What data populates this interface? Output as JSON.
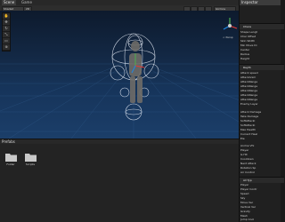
{
  "tabs": {
    "scene": "Scene",
    "game": "Game",
    "inspector": "Inspector"
  },
  "toolbar": {
    "shading": "Shaded",
    "two_d": "2D",
    "gizmos": "Gizmos"
  },
  "scene": {
    "persp_label": "< Persp"
  },
  "bottom": {
    "folder_title": "Prefabs",
    "folders": [
      "Folder",
      "Scripts"
    ]
  },
  "inspector": {
    "header": "Chara",
    "rows_a": [
      "Shape Lengt",
      "Char Offset",
      "Skin Width",
      "Min Move Di",
      "Center",
      "Radius",
      "Height"
    ],
    "section1": "Rayth",
    "rows_b": [
      "Attack speed",
      "AttackAnim",
      "AttackRange",
      "AttackRange",
      "AttackRange",
      "AttackRange",
      "AttackRange",
      "Enemy Layer"
    ],
    "rows_c": [
      "Attack Damage",
      "Take Damage",
      "SoftAttacki",
      "SoftAttacki",
      "Max Health",
      "Current Heal",
      "Ele"
    ],
    "rows_d": [
      "Anime Vfx",
      "Player",
      "Is Hit",
      "Cooldown",
      "Next Attack",
      "Rotation Sp",
      "Air Control"
    ],
    "section2": "All Typ",
    "rows_e": [
      "Player",
      "Player Contr",
      "Speed",
      "Sky",
      "Move Vec",
      "Vertical Vel",
      "Gravity",
      "Mesh",
      "Jump Cool"
    ]
  },
  "colors": {
    "sky_top": "#0d1a2d",
    "sky_bottom": "#1b3e69",
    "panel": "#202020",
    "accent": "#3a79c2"
  }
}
